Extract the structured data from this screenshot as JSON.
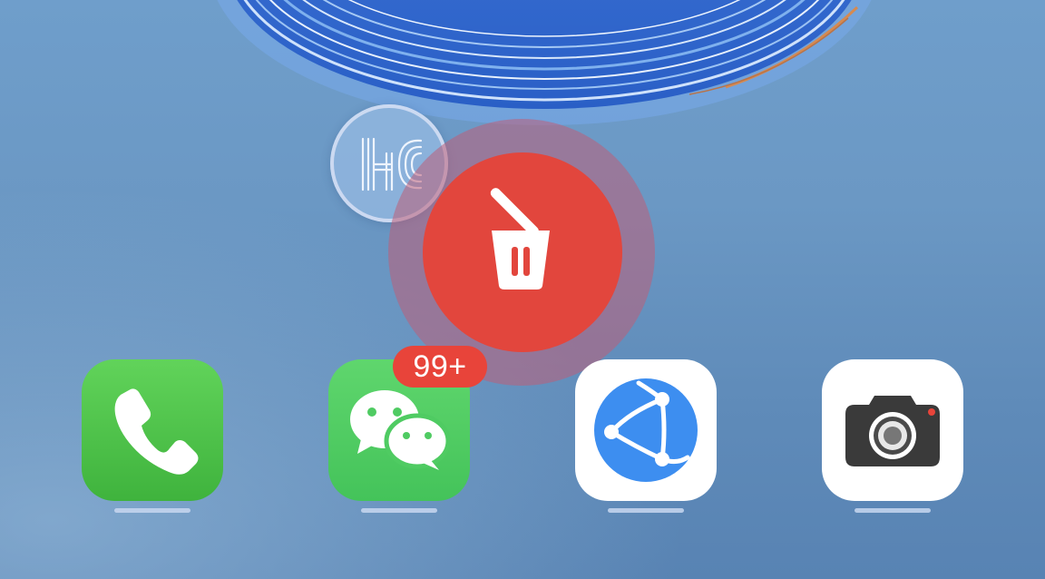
{
  "home_screen": {
    "floating_bubble": {
      "icon": "hc-logo-icon"
    },
    "delete_target": {
      "icon": "trash-icon",
      "color": "#e2463d"
    },
    "dock": [
      {
        "id": "phone",
        "icon": "phone-icon",
        "color": "#4cc447"
      },
      {
        "id": "wechat",
        "icon": "wechat-icon",
        "color": "#4fcb62",
        "badge": "99+"
      },
      {
        "id": "browser",
        "icon": "browser-globe-icon",
        "color": "#3d8ef0"
      },
      {
        "id": "camera",
        "icon": "camera-icon",
        "color": "#3a3a3a"
      }
    ]
  }
}
